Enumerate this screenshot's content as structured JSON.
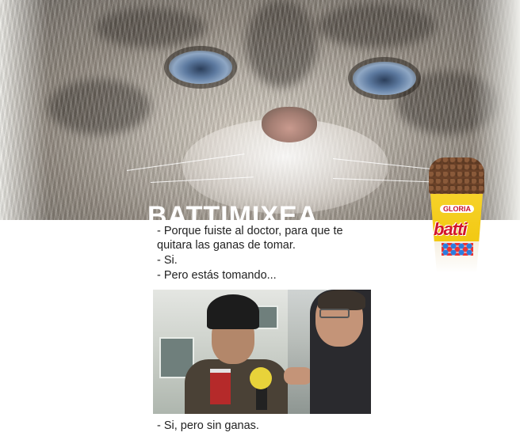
{
  "watermark": "BATTIMIXEA",
  "meme": {
    "line1": "- Porque fuiste al doctor, para que te",
    "line2": "quitara las ganas de tomar.",
    "line3": "- Si.",
    "line4": "- Pero estás tomando...",
    "caption": "- Si, pero sin ganas."
  },
  "product": {
    "brand": "GLORIA",
    "name": "batti"
  }
}
